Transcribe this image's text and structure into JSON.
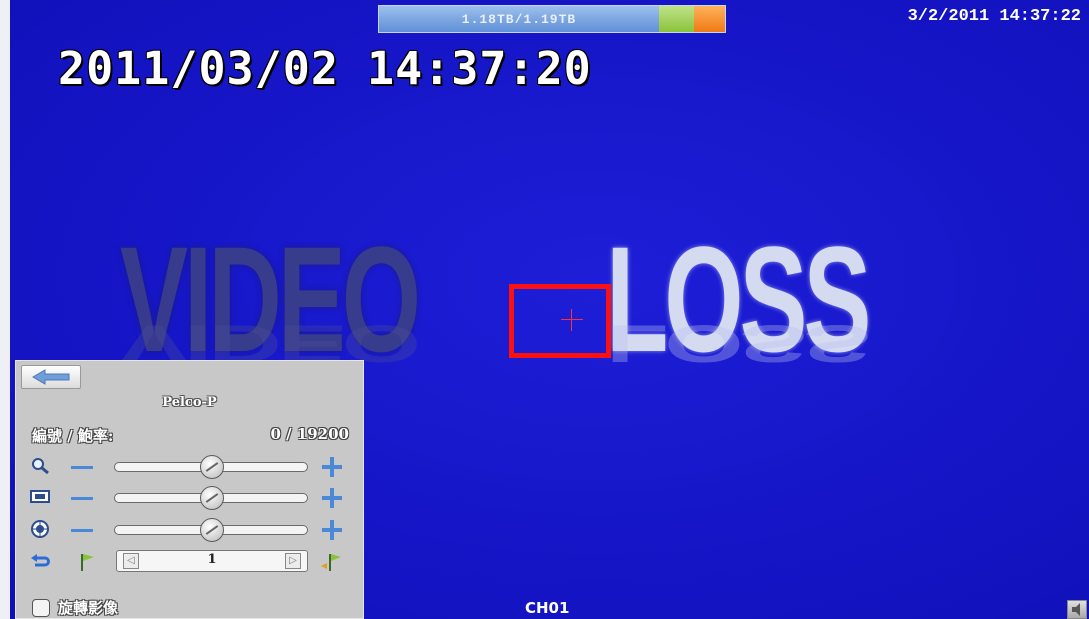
{
  "status_bar": {
    "storage_text": "1.18TB/1.19TB",
    "storage_used_fraction": 0.99,
    "clock": "3/2/2011 14:37:22"
  },
  "osd": {
    "timestamp": "2011/03/02  14:37:20",
    "video_loss_word1": "VIDEO",
    "video_loss_word2": "LOSS",
    "channel": "CH01"
  },
  "ptz_panel": {
    "protocol": "Pelco-P",
    "address_label": "編號 / 鮑率:",
    "address_value": "0 / 19200",
    "zoom_level": 0.5,
    "focus_level": 0.5,
    "iris_level": 0.5,
    "preset_value": "1",
    "option_label": "旋轉影像",
    "option_checked": false,
    "accent_color": "#4a88d8"
  },
  "icons": {
    "back": "back-arrow-icon",
    "zoom": "magnifier-icon",
    "focus": "focus-icon",
    "iris": "iris-icon",
    "return": "return-icon",
    "preset_set": "flag-icon",
    "preset_go": "flag-go-icon",
    "audio": "speaker-icon"
  }
}
